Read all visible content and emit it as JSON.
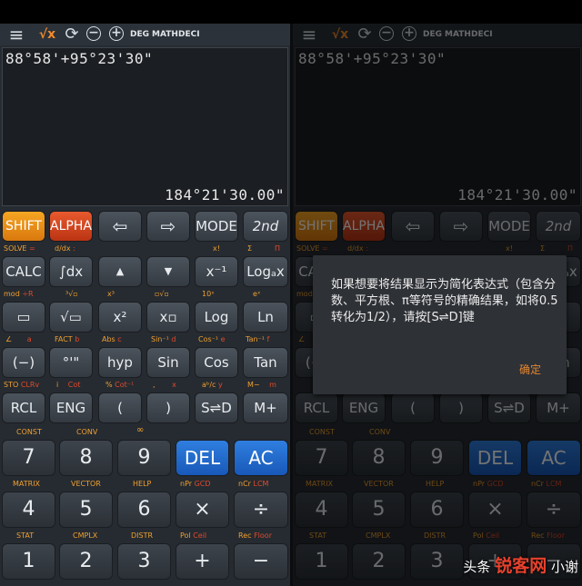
{
  "toolbar": {
    "menu_icon": "≡",
    "sqrt_icon": "√x",
    "swap_icon": "⟳",
    "minus_icon": "−",
    "plus_icon": "+",
    "mode_deg": "DEG",
    "mode_math": "MATH",
    "mode_deci": "DECI"
  },
  "display": {
    "expression": "88°58'+95°23'30\"",
    "result": "184°21'30.00\""
  },
  "keys": {
    "shift": "SHIFT",
    "alpha": "ALPHA",
    "left": "⇦",
    "right": "⇨",
    "mode": "MODE",
    "nd": "2nd",
    "calc": "CALC",
    "integral": "∫dx",
    "up": "▲",
    "down": "▼",
    "inverse": "x⁻¹",
    "log_base": "Logₐx",
    "fraction": "▭",
    "sqrt": "√▭",
    "square": "x²",
    "power": "x▫",
    "log": "Log",
    "ln": "Ln",
    "neg": "(−)",
    "dms": "°'\"",
    "hyp": "hyp",
    "sin": "Sin",
    "cos": "Cos",
    "tan": "Tan",
    "rcl": "RCL",
    "eng": "ENG",
    "lparen": "(",
    "rparen": ")",
    "sd": "S⇌D",
    "mplus": "M+",
    "d7": "7",
    "d8": "8",
    "d9": "9",
    "del": "DEL",
    "ac": "AC",
    "d4": "4",
    "d5": "5",
    "d6": "6",
    "times": "×",
    "divide": "÷",
    "d1": "1",
    "d2": "2",
    "d3": "3",
    "add": "+",
    "subtract": "−"
  },
  "secondary": {
    "row1": [
      "SOLVE",
      "=",
      "d/dx",
      ":",
      "x!",
      "Σ",
      "Π"
    ],
    "row2": [
      "mod",
      "÷R",
      "³√▫",
      "x³",
      "▫√▫",
      "10ˣ",
      "eˣ"
    ],
    "row3": [
      "∠",
      "a",
      "FACT",
      "b",
      "Abs",
      "c",
      "Sin⁻¹",
      "d",
      "Cos⁻¹",
      "e",
      "Tan⁻¹",
      "f"
    ],
    "row4": [
      "STO",
      "CLRv",
      "i",
      "Cot",
      "%",
      "Cot⁻¹",
      ",",
      "x",
      "aᵇ/c",
      "y",
      "M−",
      "m"
    ],
    "row5": [
      "CONST",
      "CONV",
      "∞"
    ],
    "row6": [
      "MATRIX",
      "VECTOR",
      "HELP",
      "nPr",
      "GCD",
      "nCr",
      "LCM"
    ],
    "row7": [
      "STAT",
      "CMPLX",
      "DISTR",
      "Pol",
      "Ceil",
      "Rec",
      "Floor"
    ]
  },
  "dialog": {
    "message": "如果想要将结果显示为简化表达式（包含分数、平方根、π等符号的精确结果，如将0.5转化为1/2），请按[S⇌D]键",
    "ok_label": "确定"
  },
  "watermark": {
    "prefix": "头条",
    "brand": "锐客网",
    "suffix": "小谢"
  },
  "colors": {
    "shift": "#f6a623",
    "alpha": "#e85a2e",
    "del_ac": "#2f7fe0",
    "dialog_ok": "#e4852f",
    "background": "#262b31"
  }
}
